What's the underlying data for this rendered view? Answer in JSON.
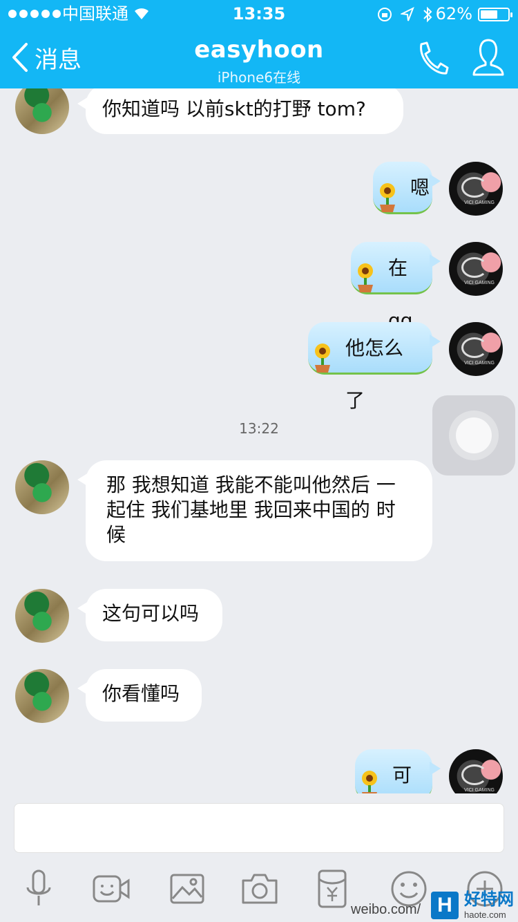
{
  "status_bar": {
    "carrier": "中国联通",
    "time": "13:35",
    "battery_percent": "62%",
    "battery_level": 0.62
  },
  "nav": {
    "back_label": "消息",
    "title": "easyhoon",
    "subtitle": "iPhone6在线",
    "icons": [
      "call-icon",
      "profile-icon"
    ]
  },
  "messages": [
    {
      "side": "left",
      "text": "你知道吗 以前skt的打野 tom?"
    },
    {
      "side": "right",
      "text": "嗯"
    },
    {
      "side": "right",
      "text": "在qg"
    },
    {
      "side": "right",
      "text": "他怎么了"
    },
    {
      "side": "time",
      "text": "13:22"
    },
    {
      "side": "left",
      "text": "那 我想知道 我能不能叫他然后 一起住 我们基地里 我回来中国的 时候"
    },
    {
      "side": "left",
      "text": "这句可以吗"
    },
    {
      "side": "left",
      "text": "你看懂吗"
    },
    {
      "side": "right",
      "text": "可以"
    }
  ],
  "avatar_right_caption": "VICI GAMING",
  "input": {
    "placeholder": ""
  },
  "toolbar": [
    "mic-icon",
    "video-icon",
    "image-icon",
    "camera-icon",
    "red-packet-icon",
    "emoji-icon",
    "plus-icon"
  ],
  "watermark": {
    "logo": "H",
    "name": "好特网",
    "url": "haote.com",
    "weibo": "weibo.com/"
  },
  "colors": {
    "nav_bg": "#13b7f5",
    "chat_bg": "#ebedf1",
    "sent_bubble": "#bfe6fd"
  }
}
